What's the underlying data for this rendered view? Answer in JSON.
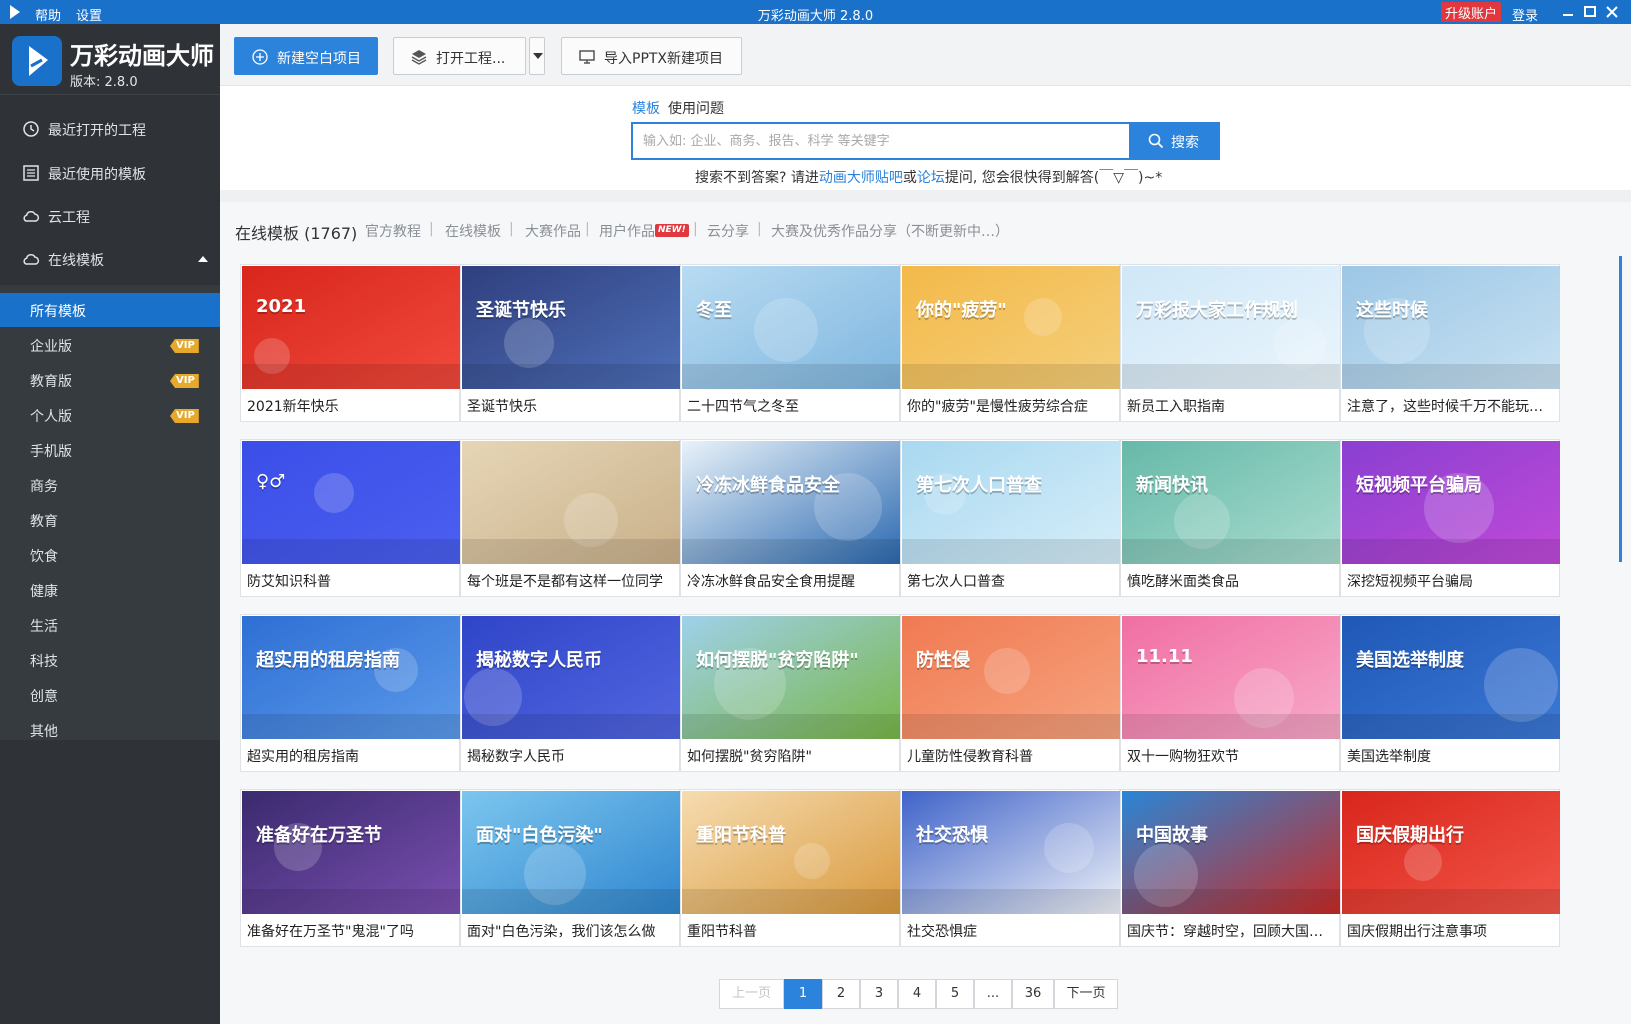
{
  "titlebar": {
    "menu_help": "帮助",
    "menu_settings": "设置",
    "window_title": "万彩动画大师 2.8.0",
    "upgrade": "升级账户",
    "login": "登录"
  },
  "brand": {
    "name": "万彩动画大师",
    "version": "版本: 2.8.0"
  },
  "nav": {
    "recent_projects": "最近打开的工程",
    "recent_templates": "最近使用的模板",
    "cloud_project": "云工程",
    "online_templates": "在线模板"
  },
  "categories": [
    {
      "label": "所有模板",
      "vip": false,
      "active": true
    },
    {
      "label": "企业版",
      "vip": true
    },
    {
      "label": "教育版",
      "vip": true
    },
    {
      "label": "个人版",
      "vip": true
    },
    {
      "label": "手机版",
      "vip": false
    },
    {
      "label": "商务",
      "vip": false
    },
    {
      "label": "教育",
      "vip": false
    },
    {
      "label": "饮食",
      "vip": false
    },
    {
      "label": "健康",
      "vip": false
    },
    {
      "label": "生活",
      "vip": false
    },
    {
      "label": "科技",
      "vip": false
    },
    {
      "label": "创意",
      "vip": false
    },
    {
      "label": "其他",
      "vip": false
    }
  ],
  "vip_label": "VIP",
  "toolbar": {
    "new_blank": "新建空白项目",
    "open_project": "打开工程...",
    "import_pptx": "导入PPTX新建项目"
  },
  "search": {
    "tab_templates": "模板",
    "tab_questions": "使用问题",
    "placeholder": "输入如: 企业、商务、报告、科学 等关键字",
    "button": "搜索",
    "hint_prefix": "搜索不到答案? 请进",
    "hint_link1": "动画大师贴吧",
    "hint_or": "或",
    "hint_link2": "论坛",
    "hint_suffix": "提问, 您会很快得到解答(￣▽￣)~*"
  },
  "filters": {
    "title": "在线模板 (1767)",
    "items": [
      "官方教程",
      "在线模板",
      "大赛作品",
      "用户作品",
      "云分享",
      "大赛及优秀作品分享（不断更新中…）"
    ],
    "new_badge": "NEW!"
  },
  "templates": [
    {
      "title": "2021新年快乐",
      "thumb_text": "2021",
      "bg1": "#d9261c",
      "bg2": "#f04a3c"
    },
    {
      "title": "圣诞节快乐",
      "thumb_text": "圣诞节快乐",
      "bg1": "#2f3f7e",
      "bg2": "#4e6fb8"
    },
    {
      "title": "二十四节气之冬至",
      "thumb_text": "冬至",
      "bg1": "#b8dbf2",
      "bg2": "#7fb6df"
    },
    {
      "title": "你的\"疲劳\"是慢性疲劳综合症",
      "thumb_text": "你的\"疲劳\"",
      "bg1": "#f3b94a",
      "bg2": "#f5cf7a"
    },
    {
      "title": "新员工入职指南",
      "thumb_text": "万彩报大家工作规划",
      "bg1": "#cfe7f7",
      "bg2": "#eaf5fc"
    },
    {
      "title": "注意了，这些时候千万不能玩手机",
      "thumb_text": "这些时候",
      "bg1": "#9cc7e6",
      "bg2": "#c8e1f2"
    },
    {
      "title": "防艾知识科普",
      "thumb_text": "♀♂",
      "bg1": "#3b4ee8",
      "bg2": "#4b5ff0"
    },
    {
      "title": "每个班是不是都有这样一位同学",
      "thumb_text": "",
      "bg1": "#e6d6b6",
      "bg2": "#c9b08a"
    },
    {
      "title": "冷冻冰鲜食品安全食用提醒",
      "thumb_text": "冷冻冰鲜食品安全",
      "bg1": "#e9f3fa",
      "bg2": "#2b69b0"
    },
    {
      "title": "第七次人口普查",
      "thumb_text": "第七次人口普查",
      "bg1": "#a9d8f0",
      "bg2": "#d6eef9"
    },
    {
      "title": "慎吃酵米面类食品",
      "thumb_text": "新闻快讯",
      "bg1": "#66b9a9",
      "bg2": "#a9dccf"
    },
    {
      "title": "深挖短视频平台骗局",
      "thumb_text": "短视频平台骗局",
      "bg1": "#8a3fd1",
      "bg2": "#c04ad8"
    },
    {
      "title": "超实用的租房指南",
      "thumb_text": "超实用的租房指南",
      "bg1": "#2e6fd4",
      "bg2": "#5c9aea"
    },
    {
      "title": "揭秘数字人民币",
      "thumb_text": "揭秘数字人民币",
      "bg1": "#2f45c8",
      "bg2": "#5266e0"
    },
    {
      "title": "如何摆脱\"贫穷陷阱\"",
      "thumb_text": "如何摆脱\"贫穷陷阱\"",
      "bg1": "#9fd1ea",
      "bg2": "#79b648"
    },
    {
      "title": "儿童防性侵教育科普",
      "thumb_text": "防性侵",
      "bg1": "#f07a52",
      "bg2": "#f6a37f"
    },
    {
      "title": "双十一购物狂欢节",
      "thumb_text": "11.11",
      "bg1": "#f06fa3",
      "bg2": "#f8a9c9"
    },
    {
      "title": "美国选举制度",
      "thumb_text": "美国选举制度",
      "bg1": "#1f58b7",
      "bg2": "#3c78d6"
    },
    {
      "title": "准备好在万圣节\"鬼混\"了吗",
      "thumb_text": "准备好在万圣节",
      "bg1": "#3a2a6e",
      "bg2": "#7a4fb0"
    },
    {
      "title": "面对\"白色污染，我们该怎么做",
      "thumb_text": "面对\"白色污染\"",
      "bg1": "#7cc6ef",
      "bg2": "#2f86cf"
    },
    {
      "title": "重阳节科普",
      "thumb_text": "重阳节科普",
      "bg1": "#f6dcb0",
      "bg2": "#d99a3e"
    },
    {
      "title": "社交恐惧症",
      "thumb_text": "社交恐惧",
      "bg1": "#3f63c9",
      "bg2": "#eef1f7"
    },
    {
      "title": "国庆节：穿越时空，回顾大国崛起",
      "thumb_text": "中国故事",
      "bg1": "#2a86d6",
      "bg2": "#c92a25"
    },
    {
      "title": "国庆假期出行注意事项",
      "thumb_text": "国庆假期出行",
      "bg1": "#d9261c",
      "bg2": "#f25548"
    }
  ],
  "pagination": {
    "prev": "上一页",
    "pages": [
      "1",
      "2",
      "3",
      "4",
      "5",
      "...",
      "36"
    ],
    "current": "1",
    "next": "下一页"
  },
  "colors": {
    "accent": "#2b83dc",
    "titlebar": "#1a71c9",
    "sidebar": "#2f3337",
    "vip": "#e6a92b",
    "upgrade": "#e0383e"
  }
}
